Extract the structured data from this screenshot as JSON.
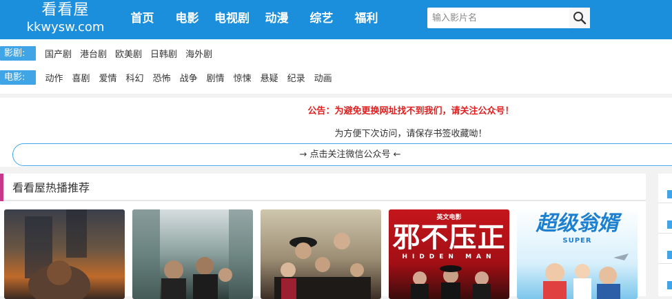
{
  "site": {
    "logo_line1": "看看屋",
    "logo_line2": "kkwysw.com"
  },
  "nav": [
    "首页",
    "电影",
    "电视剧",
    "动漫",
    "综艺",
    "福利"
  ],
  "search": {
    "placeholder": "输入影片名"
  },
  "categories": {
    "drama": {
      "label": "影剧:",
      "items": [
        "国产剧",
        "港台剧",
        "欧美剧",
        "日韩剧",
        "海外剧"
      ]
    },
    "movie": {
      "label": "电影:",
      "items": [
        "动作",
        "喜剧",
        "爱情",
        "科幻",
        "恐怖",
        "战争",
        "剧情",
        "惊悚",
        "悬疑",
        "纪录",
        "动画"
      ]
    }
  },
  "notice": {
    "announcement": "公告：为避免更换网址找不到我们，请关注公众号！",
    "bookmark_tip": "为方便下次访问，请保存书签收藏呦！",
    "follow_button": "→ 点击关注微信公众号 ←"
  },
  "hot": {
    "title": "看看屋热播推荐",
    "posters": [
      {
        "name": "skyscraper-poster",
        "text": ""
      },
      {
        "name": "city-action-poster",
        "text": ""
      },
      {
        "name": "period-drama-poster",
        "text": ""
      },
      {
        "name": "hidden-man-poster",
        "text": "邪不压正",
        "subtext": "HIDDEN MAN",
        "brand": "英文电影"
      },
      {
        "name": "super-son-in-law-poster",
        "text": "超级翁婿",
        "subtext": "SUPER"
      }
    ]
  },
  "colors": {
    "header": "#1c8fdc",
    "label": "#3fa5e6",
    "notice_red": "#e02020",
    "section_bar": "#c8378a"
  }
}
